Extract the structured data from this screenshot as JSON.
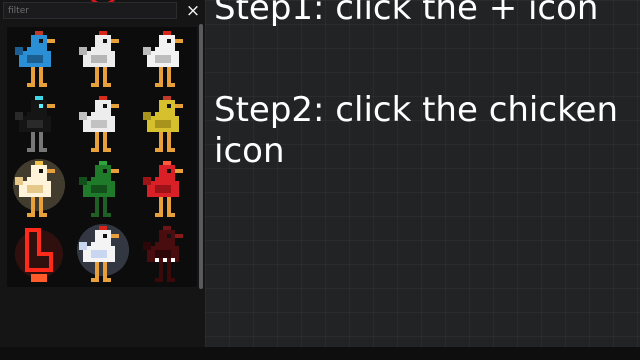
{
  "panel": {
    "filter": {
      "placeholder": "filter",
      "value": ""
    },
    "close_label": "×",
    "chickens": [
      {
        "name": "blue-chicken-icon",
        "body": "#2b8fd6",
        "dark": "#1a5e92",
        "comb": "#c0392b",
        "leg": "#e8a13a"
      },
      {
        "name": "white-chicken-icon",
        "body": "#ececec",
        "dark": "#b5b5b5",
        "comb": "#d9241b",
        "leg": "#e8a13a"
      },
      {
        "name": "white-chicken-large-icon",
        "body": "#f2f2f2",
        "dark": "#bdbdbd",
        "comb": "#d9241b",
        "leg": "#e8a13a"
      },
      {
        "name": "black-chicken-icon",
        "body": "#151515",
        "dark": "#2a2a2a",
        "comb": "#3fd6e6",
        "leg": "#777777",
        "eye": "#5ff0ff"
      },
      {
        "name": "white-red-chicken-icon",
        "body": "#ededed",
        "dark": "#c2c2c2",
        "comb": "#d92b1b",
        "leg": "#e8a13a"
      },
      {
        "name": "yellow-chicken-icon",
        "body": "#d6c02e",
        "dark": "#a8931c",
        "comb": "#c0392b",
        "leg": "#e8a13a"
      },
      {
        "name": "glowing-chicken-icon",
        "body": "#fff4da",
        "dark": "#e6c98a",
        "comb": "#f0c24a",
        "leg": "#e8a13a",
        "glow": "#ffe9a8"
      },
      {
        "name": "green-chicken-icon",
        "body": "#1f7a2a",
        "dark": "#134f1b",
        "comb": "#2fa33c",
        "leg": "#1f5f25"
      },
      {
        "name": "red-chicken-icon",
        "body": "#d92027",
        "dark": "#9c1418",
        "comb": "#ff5a3a",
        "leg": "#e8a13a"
      },
      {
        "name": "neon-chicken-icon",
        "body": "none",
        "dark": "#ff2a1a",
        "comb": "#ff2a1a",
        "leg": "#ff2a1a",
        "neon": true
      },
      {
        "name": "white-bandana-chicken-icon",
        "body": "#f4f4f4",
        "dark": "#c9d6f0",
        "comb": "#d9241b",
        "leg": "#e8a13a",
        "glow": "#bcd3ff"
      },
      {
        "name": "dark-red-chicken-icon",
        "body": "#4a0d0f",
        "dark": "#2d0607",
        "comb": "#6e1416",
        "leg": "#3a0a0b",
        "teeth": true
      }
    ]
  },
  "instructions": {
    "step1": "Step1: click the + icon",
    "step2": "Step2: click the chicken icon"
  },
  "colors": {
    "background": "#222325",
    "panel": "#151516",
    "accent_red": "#d9141b",
    "text": "#ffffff"
  }
}
